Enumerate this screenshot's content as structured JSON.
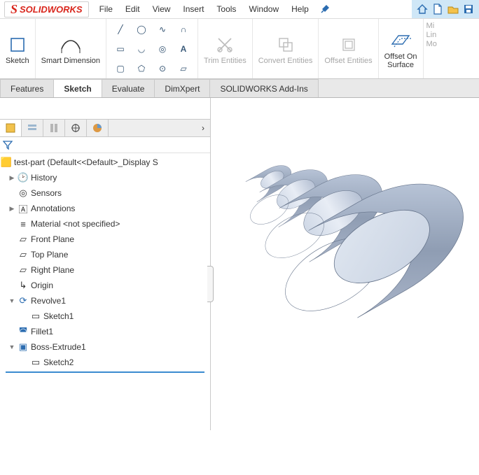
{
  "brand": {
    "name": "SOLIDWORKS"
  },
  "menu": [
    "File",
    "Edit",
    "View",
    "Insert",
    "Tools",
    "Window",
    "Help"
  ],
  "ribbon": {
    "sketch": "Sketch",
    "smart_dimension": "Smart Dimension",
    "trim": "Trim Entities",
    "convert": "Convert Entities",
    "offset": "Offset Entities",
    "offset_surface_l1": "Offset On",
    "offset_surface_l2": "Surface",
    "side": [
      "Mi",
      "Lin",
      "Mo"
    ]
  },
  "cm_tabs": [
    "Features",
    "Sketch",
    "Evaluate",
    "DimXpert",
    "SOLIDWORKS Add-Ins"
  ],
  "cm_active": 1,
  "tree": {
    "root": "test-part  (Default<<Default>_Display S",
    "history": "History",
    "sensors": "Sensors",
    "annotations": "Annotations",
    "material": "Material <not specified>",
    "front": "Front Plane",
    "top": "Top Plane",
    "right": "Right Plane",
    "origin": "Origin",
    "revolve": "Revolve1",
    "sketch1": "Sketch1",
    "fillet": "Fillet1",
    "boss": "Boss-Extrude1",
    "sketch2": "Sketch2"
  }
}
